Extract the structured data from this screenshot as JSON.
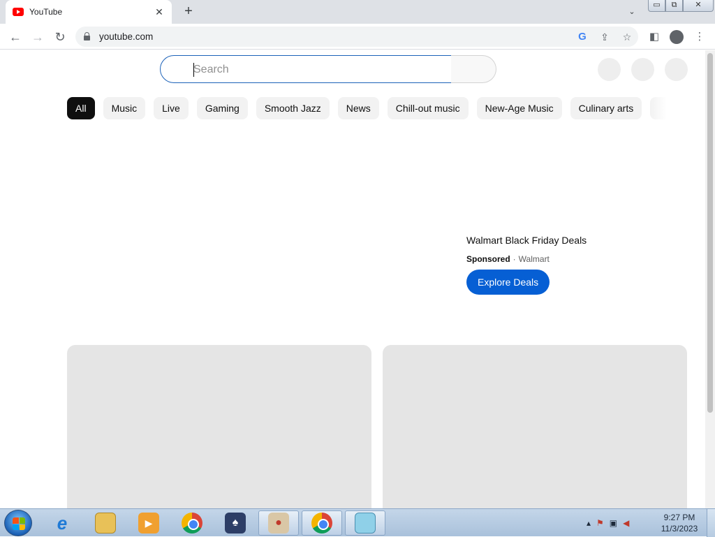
{
  "browser": {
    "tab_title": "YouTube",
    "tab_close": "✕",
    "new_tab": "+",
    "tab_list": "⌄",
    "url": "youtube.com",
    "window_controls": {
      "minimize": "▭",
      "maximize": "⧉",
      "close": "✕"
    }
  },
  "toolbar": {
    "back": "←",
    "forward": "→",
    "reload": "↻",
    "google": "G",
    "share": "⇪",
    "bookmark": "☆",
    "side_panel": "◧",
    "menu": "⋮"
  },
  "youtube": {
    "search": {
      "placeholder": "Search",
      "value": ""
    },
    "chips": [
      {
        "label": "All",
        "active": true
      },
      {
        "label": "Music"
      },
      {
        "label": "Live"
      },
      {
        "label": "Gaming"
      },
      {
        "label": "Smooth Jazz"
      },
      {
        "label": "News"
      },
      {
        "label": "Chill-out music"
      },
      {
        "label": "New-Age Music"
      },
      {
        "label": "Culinary arts"
      }
    ],
    "ad": {
      "title": "Walmart Black Friday Deals",
      "sponsored": "Sponsored",
      "separator": "·",
      "advertiser": "Walmart",
      "cta": "Explore Deals"
    }
  },
  "taskbar": {
    "apps": [
      "internet-explorer",
      "file-explorer",
      "media-player",
      "chrome",
      "solitaire",
      "paint",
      "chrome",
      "notepad"
    ],
    "tray": {
      "overflow": "▴"
    },
    "clock": {
      "time": "9:27 PM",
      "date": "11/3/2023"
    }
  },
  "colors": {
    "accent": "#065fd4",
    "chip_active": "#0f0f0f",
    "chip_bg": "#f2f2f2",
    "youtube_red": "#ff0000",
    "search_focus_border": "#1c62b9"
  }
}
